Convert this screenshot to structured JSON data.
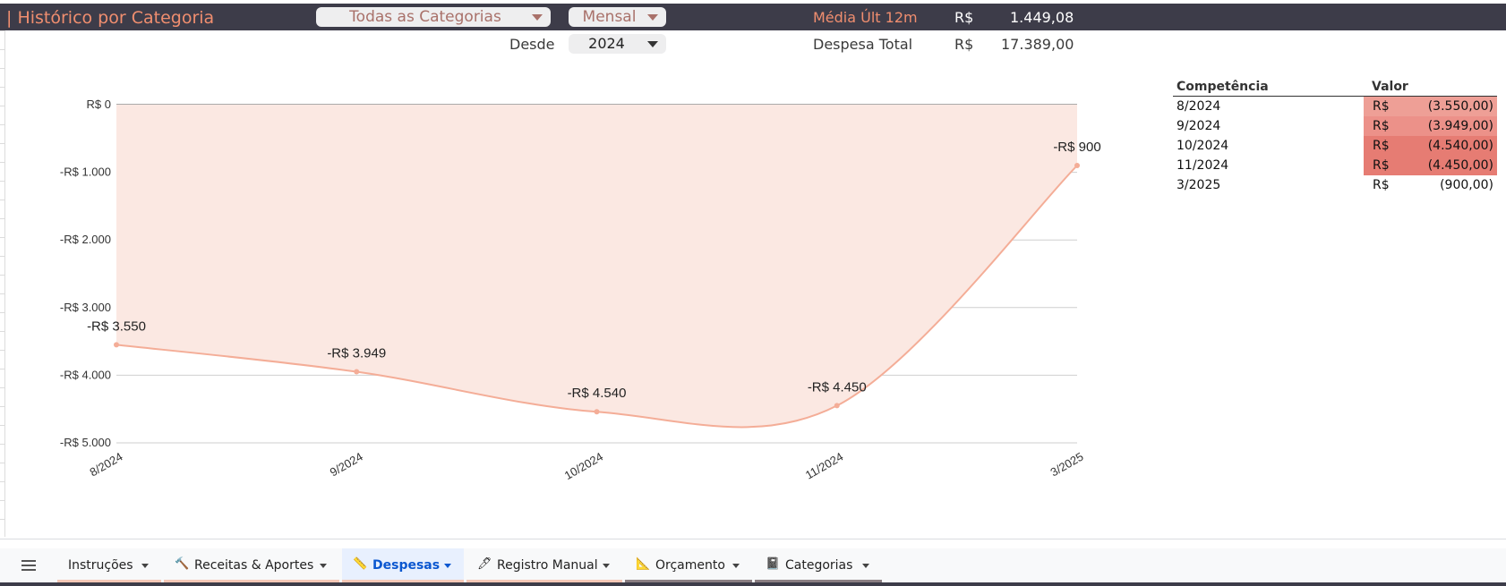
{
  "header": {
    "title": "| Histórico por Categoria",
    "category_dropdown": "Todas as Categorias",
    "period_dropdown": "Mensal",
    "avg_label": "Média Últ 12m",
    "avg_currency": "R$",
    "avg_value": "1.449,08",
    "since_label": "Desde",
    "since_dropdown": "2024",
    "total_label": "Despesa Total",
    "total_currency": "R$",
    "total_value": "17.389,00"
  },
  "chart_data": {
    "type": "area",
    "x": [
      "8/2024",
      "9/2024",
      "10/2024",
      "11/2024",
      "3/2025"
    ],
    "values": [
      -3550,
      -3949,
      -4540,
      -4450,
      -900
    ],
    "data_labels": [
      "-R$ 3.550",
      "-R$ 3.949",
      "-R$ 4.540",
      "-R$ 4.450",
      "-R$ 900"
    ],
    "y_ticks": [
      0,
      -1000,
      -2000,
      -3000,
      -4000,
      -5000
    ],
    "y_tick_labels": [
      "R$ 0",
      "-R$ 1.000",
      "-R$ 2.000",
      "-R$ 3.000",
      "-R$ 4.000",
      "-R$ 5.000"
    ],
    "ylim": [
      -5000,
      0
    ],
    "grid": true,
    "line_color": "#f4ad97",
    "fill_color": "#fbe8e2"
  },
  "table": {
    "col_competencia": "Competência",
    "col_valor": "Valor",
    "rows": [
      {
        "competencia": "8/2024",
        "currency": "R$",
        "valor": "(3.550,00)",
        "color": "#ee9f96"
      },
      {
        "competencia": "9/2024",
        "currency": "R$",
        "valor": "(3.949,00)",
        "color": "#ec9189"
      },
      {
        "competencia": "10/2024",
        "currency": "R$",
        "valor": "(4.540,00)",
        "color": "#e67c73"
      },
      {
        "competencia": "11/2024",
        "currency": "R$",
        "valor": "(4.450,00)",
        "color": "#e67c73"
      },
      {
        "competencia": "3/2025",
        "currency": "R$",
        "valor": "(900,00)",
        "color": "#ffffff"
      }
    ]
  },
  "tabs": [
    {
      "label": "Instruções",
      "icon": "",
      "underline": "#f4c7b6",
      "active": false
    },
    {
      "label": "Receitas & Aportes",
      "icon": "hammer-icon",
      "underline": "#f4c7b6",
      "active": false
    },
    {
      "label": "Despesas",
      "icon": "ruler-icon",
      "underline": "#f4c7b6",
      "active": true
    },
    {
      "label": "Registro Manual",
      "icon": "pen-icon",
      "underline": "#f4c7b6",
      "active": false
    },
    {
      "label": "Orçamento",
      "icon": "triangle-ruler-icon",
      "underline": "#8a7e82",
      "active": false
    },
    {
      "label": "Categorias",
      "icon": "book-icon",
      "underline": "#8a7e82",
      "active": false
    }
  ]
}
